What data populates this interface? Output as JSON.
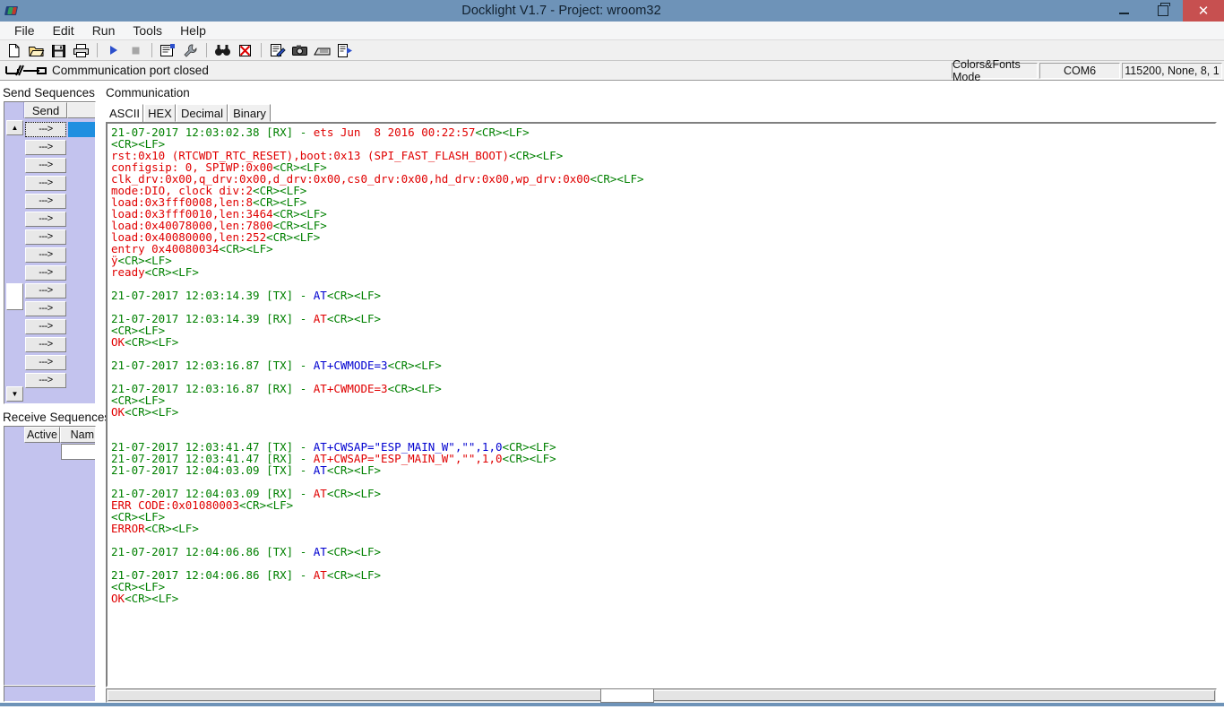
{
  "window": {
    "title": "Docklight V1.7 - Project: wroom32",
    "logo_icon": "docklight-logo-icon",
    "minimize_label": "Minimize",
    "maximize_label": "Restore",
    "close_label": "Close"
  },
  "menu": {
    "items": [
      {
        "label": "File"
      },
      {
        "label": "Edit"
      },
      {
        "label": "Run"
      },
      {
        "label": "Tools"
      },
      {
        "label": "Help"
      }
    ]
  },
  "toolbar": {
    "buttons": [
      {
        "icon": "new-file-icon",
        "label": "New"
      },
      {
        "icon": "open-folder-icon",
        "label": "Open"
      },
      {
        "icon": "save-disk-icon",
        "label": "Save"
      },
      {
        "icon": "print-icon",
        "label": "Print"
      },
      {
        "icon": "play-start-icon",
        "label": "Start Communication"
      },
      {
        "icon": "stop-square-icon",
        "label": "Stop Communication"
      },
      {
        "icon": "properties-icon",
        "label": "Project Settings"
      },
      {
        "icon": "wrench-icon",
        "label": "Tools"
      },
      {
        "icon": "binoculars-icon",
        "label": "Find"
      },
      {
        "icon": "clear-red-x-icon",
        "label": "Clear Communication"
      },
      {
        "icon": "edit-document-icon",
        "label": "Edit"
      },
      {
        "icon": "camera-icon",
        "label": "Snapshot"
      },
      {
        "icon": "keyboard-icon",
        "label": "Keyboard Console"
      },
      {
        "icon": "export-doc-icon",
        "label": "Export"
      }
    ]
  },
  "status_strip": {
    "connection_icon": "port-closed-icon",
    "connection_text": "Commmunication port closed",
    "mode": "Colors&Fonts Mode",
    "port": "COM6",
    "serial_settings": "115200, None, 8, 1"
  },
  "send_sequences": {
    "label": "Send Sequences",
    "header": {
      "send": "Send",
      "name": ""
    },
    "scroll_up_glyph": "▲",
    "scroll_down_glyph": "▼",
    "rows": [
      {
        "arrow": "--->",
        "selected": true
      },
      {
        "arrow": "--->",
        "selected": false
      },
      {
        "arrow": "--->",
        "selected": false
      },
      {
        "arrow": "--->",
        "selected": false
      },
      {
        "arrow": "--->",
        "selected": false
      },
      {
        "arrow": "--->",
        "selected": false
      },
      {
        "arrow": "--->",
        "selected": false
      },
      {
        "arrow": "--->",
        "selected": false
      },
      {
        "arrow": "--->",
        "selected": false
      },
      {
        "arrow": "--->",
        "selected": false
      },
      {
        "arrow": "--->",
        "selected": false
      },
      {
        "arrow": "--->",
        "selected": false
      },
      {
        "arrow": "--->",
        "selected": false
      },
      {
        "arrow": "--->",
        "selected": false
      },
      {
        "arrow": "--->",
        "selected": false
      }
    ]
  },
  "receive_sequences": {
    "label": "Receive Sequences",
    "header": {
      "active": "Active",
      "name": "Nam"
    }
  },
  "communication": {
    "label": "Communication",
    "tabs": [
      {
        "label": "ASCII",
        "active": true
      },
      {
        "label": "HEX",
        "active": false
      },
      {
        "label": "Decimal",
        "active": false
      },
      {
        "label": "Binary",
        "active": false
      }
    ],
    "lines": [
      {
        "segments": [
          {
            "text": "21-07-2017 12:03:02.38 [RX] - ",
            "color": "green"
          },
          {
            "text": "ets Jun  8 2016 00:22:57",
            "color": "red"
          },
          {
            "text": "<CR><LF>",
            "color": "green"
          }
        ]
      },
      {
        "segments": [
          {
            "text": "<CR><LF>",
            "color": "green"
          }
        ]
      },
      {
        "segments": [
          {
            "text": "rst:0x10 (RTCWDT_RTC_RESET),boot:0x13 (SPI_FAST_FLASH_BOOT)",
            "color": "red"
          },
          {
            "text": "<CR><LF>",
            "color": "green"
          }
        ]
      },
      {
        "segments": [
          {
            "text": "configsip: 0, SPIWP:0x00",
            "color": "red"
          },
          {
            "text": "<CR><LF>",
            "color": "green"
          }
        ]
      },
      {
        "segments": [
          {
            "text": "clk_drv:0x00,q_drv:0x00,d_drv:0x00,cs0_drv:0x00,hd_drv:0x00,wp_drv:0x00",
            "color": "red"
          },
          {
            "text": "<CR><LF>",
            "color": "green"
          }
        ]
      },
      {
        "segments": [
          {
            "text": "mode:DIO, clock div:2",
            "color": "red"
          },
          {
            "text": "<CR><LF>",
            "color": "green"
          }
        ]
      },
      {
        "segments": [
          {
            "text": "load:0x3fff0008,len:8",
            "color": "red"
          },
          {
            "text": "<CR><LF>",
            "color": "green"
          }
        ]
      },
      {
        "segments": [
          {
            "text": "load:0x3fff0010,len:3464",
            "color": "red"
          },
          {
            "text": "<CR><LF>",
            "color": "green"
          }
        ]
      },
      {
        "segments": [
          {
            "text": "load:0x40078000,len:7800",
            "color": "red"
          },
          {
            "text": "<CR><LF>",
            "color": "green"
          }
        ]
      },
      {
        "segments": [
          {
            "text": "load:0x40080000,len:252",
            "color": "red"
          },
          {
            "text": "<CR><LF>",
            "color": "green"
          }
        ]
      },
      {
        "segments": [
          {
            "text": "entry 0x40080034",
            "color": "red"
          },
          {
            "text": "<CR><LF>",
            "color": "green"
          }
        ]
      },
      {
        "segments": [
          {
            "text": "ÿ",
            "color": "red"
          },
          {
            "text": "<CR><LF>",
            "color": "green"
          }
        ]
      },
      {
        "segments": [
          {
            "text": "ready",
            "color": "red"
          },
          {
            "text": "<CR><LF>",
            "color": "green"
          }
        ]
      },
      {
        "segments": []
      },
      {
        "segments": [
          {
            "text": "21-07-2017 12:03:14.39 [TX] - ",
            "color": "green"
          },
          {
            "text": "AT",
            "color": "blue"
          },
          {
            "text": "<CR><LF>",
            "color": "green"
          }
        ]
      },
      {
        "segments": []
      },
      {
        "segments": [
          {
            "text": "21-07-2017 12:03:14.39 [RX] - ",
            "color": "green"
          },
          {
            "text": "AT",
            "color": "red"
          },
          {
            "text": "<CR><LF>",
            "color": "green"
          }
        ]
      },
      {
        "segments": [
          {
            "text": "<CR><LF>",
            "color": "green"
          }
        ]
      },
      {
        "segments": [
          {
            "text": "OK",
            "color": "red"
          },
          {
            "text": "<CR><LF>",
            "color": "green"
          }
        ]
      },
      {
        "segments": []
      },
      {
        "segments": [
          {
            "text": "21-07-2017 12:03:16.87 [TX] - ",
            "color": "green"
          },
          {
            "text": "AT+CWMODE=3",
            "color": "blue"
          },
          {
            "text": "<CR><LF>",
            "color": "green"
          }
        ]
      },
      {
        "segments": []
      },
      {
        "segments": [
          {
            "text": "21-07-2017 12:03:16.87 [RX] - ",
            "color": "green"
          },
          {
            "text": "AT+CWMODE=3",
            "color": "red"
          },
          {
            "text": "<CR><LF>",
            "color": "green"
          }
        ]
      },
      {
        "segments": [
          {
            "text": "<CR><LF>",
            "color": "green"
          }
        ]
      },
      {
        "segments": [
          {
            "text": "OK",
            "color": "red"
          },
          {
            "text": "<CR><LF>",
            "color": "green"
          }
        ]
      },
      {
        "segments": []
      },
      {
        "segments": []
      },
      {
        "segments": [
          {
            "text": "21-07-2017 12:03:41.47 [TX] - ",
            "color": "green"
          },
          {
            "text": "AT+CWSAP=\"ESP_MAIN_W\",\"\",1,0",
            "color": "blue"
          },
          {
            "text": "<CR><LF>",
            "color": "green"
          }
        ]
      },
      {
        "segments": [
          {
            "text": "21-07-2017 12:03:41.47 [RX] - ",
            "color": "green"
          },
          {
            "text": "AT+CWSAP=\"ESP_MAIN_W\",\"\",1,0",
            "color": "red"
          },
          {
            "text": "<CR><LF>",
            "color": "green"
          }
        ]
      },
      {
        "segments": [
          {
            "text": "21-07-2017 12:04:03.09 [TX] - ",
            "color": "green"
          },
          {
            "text": "AT",
            "color": "blue"
          },
          {
            "text": "<CR><LF>",
            "color": "green"
          }
        ]
      },
      {
        "segments": []
      },
      {
        "segments": [
          {
            "text": "21-07-2017 12:04:03.09 [RX] - ",
            "color": "green"
          },
          {
            "text": "AT",
            "color": "red"
          },
          {
            "text": "<CR><LF>",
            "color": "green"
          }
        ]
      },
      {
        "segments": [
          {
            "text": "ERR CODE:0x01080003",
            "color": "red"
          },
          {
            "text": "<CR><LF>",
            "color": "green"
          }
        ]
      },
      {
        "segments": [
          {
            "text": "<CR><LF>",
            "color": "green"
          }
        ]
      },
      {
        "segments": [
          {
            "text": "ERROR",
            "color": "red"
          },
          {
            "text": "<CR><LF>",
            "color": "green"
          }
        ]
      },
      {
        "segments": []
      },
      {
        "segments": [
          {
            "text": "21-07-2017 12:04:06.86 [TX] - ",
            "color": "green"
          },
          {
            "text": "AT",
            "color": "blue"
          },
          {
            "text": "<CR><LF>",
            "color": "green"
          }
        ]
      },
      {
        "segments": []
      },
      {
        "segments": [
          {
            "text": "21-07-2017 12:04:06.86 [RX] - ",
            "color": "green"
          },
          {
            "text": "AT",
            "color": "red"
          },
          {
            "text": "<CR><LF>",
            "color": "green"
          }
        ]
      },
      {
        "segments": [
          {
            "text": "<CR><LF>",
            "color": "green"
          }
        ]
      },
      {
        "segments": [
          {
            "text": "OK",
            "color": "red"
          },
          {
            "text": "<CR><LF>",
            "color": "green"
          }
        ]
      }
    ]
  },
  "colors": {
    "titlebar": "#6e93b8",
    "close_button": "#c75050",
    "panel_purple": "#c3c3ee",
    "text_green": "#008000",
    "text_red": "#e00000",
    "text_blue": "#0000d0",
    "selection_blue": "#1f8fe0"
  }
}
